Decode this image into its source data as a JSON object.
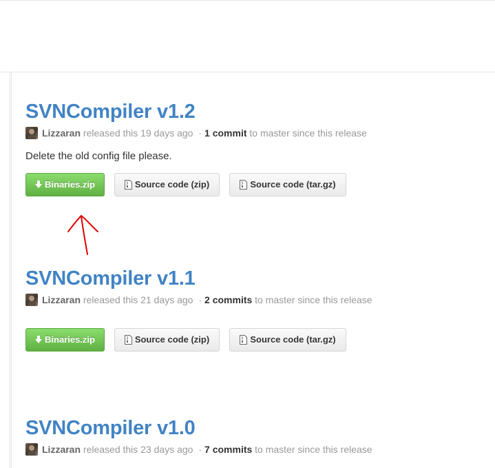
{
  "releases": [
    {
      "title": "SVNCompiler v1.2",
      "author": "Lizzaran",
      "released_text": "released this 19 days ago",
      "separator": "·",
      "commits": "1 commit",
      "commits_suffix": "to master since this release",
      "notes": "Delete the old config file please.",
      "downloads": {
        "binaries": "Binaries.zip",
        "source_zip": "Source code (zip)",
        "source_tar": "Source code (tar.gz)"
      }
    },
    {
      "title": "SVNCompiler v1.1",
      "author": "Lizzaran",
      "released_text": "released this 21 days ago",
      "separator": "·",
      "commits": "2 commits",
      "commits_suffix": "to master since this release",
      "notes": "",
      "downloads": {
        "binaries": "Binaries.zip",
        "source_zip": "Source code (zip)",
        "source_tar": "Source code (tar.gz)"
      }
    },
    {
      "title": "SVNCompiler v1.0",
      "author": "Lizzaran",
      "released_text": "released this 23 days ago",
      "separator": "·",
      "commits": "7 commits",
      "commits_suffix": "to master since this release"
    }
  ],
  "icons": {
    "download": "arrow-down-icon",
    "source": "file-zip-icon",
    "avatar": "avatar",
    "annotation": "red-hand-drawn-arrow"
  },
  "colors": {
    "title_link": "#4183c4",
    "primary_button": "#60b044",
    "annotation": "#e00000"
  }
}
